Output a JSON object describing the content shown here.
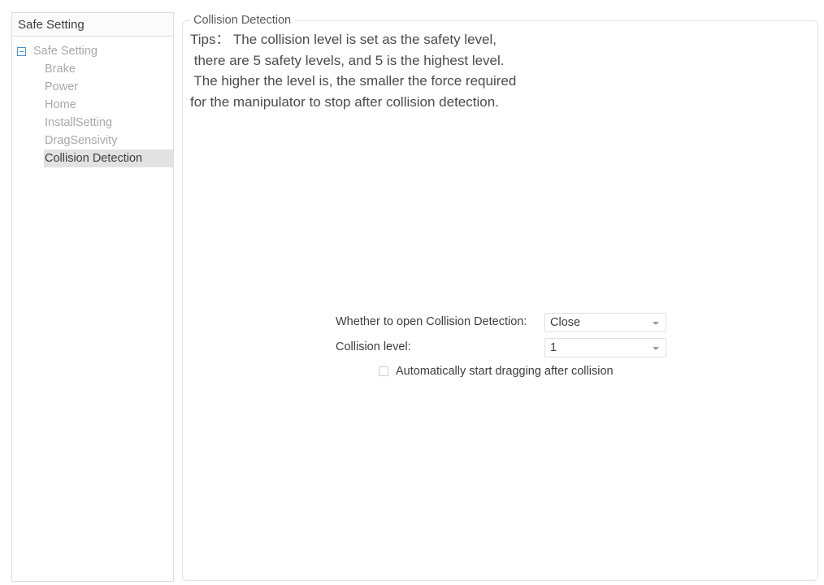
{
  "tree": {
    "header_title": "Safe Setting",
    "root": {
      "label": "Safe Setting",
      "expander_icon": "minus-box-icon"
    },
    "items": [
      {
        "label": "Brake",
        "selected": false
      },
      {
        "label": "Power",
        "selected": false
      },
      {
        "label": "Home",
        "selected": false
      },
      {
        "label": "InstallSetting",
        "selected": false
      },
      {
        "label": "DragSensivity",
        "selected": false
      },
      {
        "label": "Collision Detection",
        "selected": true
      }
    ]
  },
  "panel": {
    "group_title": "Collision Detection",
    "tips_text": "Tips： The collision level is set as the safety level,\n there are 5 safety levels, and 5 is the highest level.\n The higher the level is, the smaller the force required\nfor the manipulator to stop after collision detection.",
    "form": {
      "enable_label": "Whether to open Collision Detection:",
      "enable_value": "Close",
      "level_label": "Collision level:",
      "level_value": "1",
      "auto_drag_label": "Automatically start dragging after collision",
      "auto_drag_checked": false,
      "dropdown_arrow_icon": "chevron-down-icon",
      "checkbox_icon": "checkbox-unchecked-icon"
    }
  },
  "colors": {
    "panel_border": "#e3e3e3",
    "tree_border": "#dcdcdc",
    "selected_bg": "#e2e2e2",
    "muted_text": "#a8a8a8",
    "primary_text": "#3c3c3c",
    "expander_blue": "#4a90d9"
  }
}
